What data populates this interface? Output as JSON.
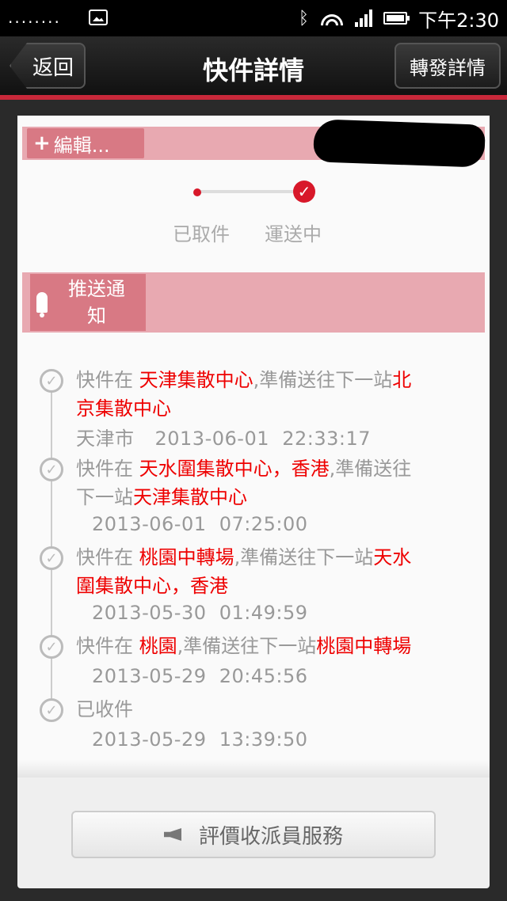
{
  "status_bar": {
    "left_text": "........",
    "time": "下午2:30"
  },
  "header": {
    "back_label": "返回",
    "title": "快件詳情",
    "forward_label": "轉發詳情"
  },
  "summary": {
    "edit_label": "編輯...",
    "steps": [
      "已取件",
      "運送中"
    ]
  },
  "notify": {
    "label_line1": "推送通",
    "label_line2": "知"
  },
  "timeline": [
    {
      "lines": [
        [
          {
            "t": "快件在 ",
            "red": false
          },
          {
            "t": "天津集散中心",
            "red": true
          },
          {
            "t": ",準備送往下一站",
            "red": false
          },
          {
            "t": "北",
            "red": true
          }
        ],
        [
          {
            "t": "京集散中心",
            "red": true
          }
        ]
      ],
      "location": "天津市",
      "time": "2013-06-01  22:33:17"
    },
    {
      "lines": [
        [
          {
            "t": "快件在 ",
            "red": false
          },
          {
            "t": "天水圍集散中心，香港",
            "red": true
          },
          {
            "t": ",準備送往",
            "red": false
          }
        ],
        [
          {
            "t": "下一站",
            "red": false
          },
          {
            "t": "天津集散中心",
            "red": true
          }
        ]
      ],
      "location": "",
      "time": "2013-06-01  07:25:00"
    },
    {
      "lines": [
        [
          {
            "t": "快件在 ",
            "red": false
          },
          {
            "t": "桃園中轉場",
            "red": true
          },
          {
            "t": ",準備送往下一站",
            "red": false
          },
          {
            "t": "天水",
            "red": true
          }
        ],
        [
          {
            "t": "圍集散中心，香港",
            "red": true
          }
        ]
      ],
      "location": "",
      "time": "2013-05-30  01:49:59"
    },
    {
      "lines": [
        [
          {
            "t": "快件在 ",
            "red": false
          },
          {
            "t": "桃園",
            "red": true
          },
          {
            "t": ",準備送往下一站",
            "red": false
          },
          {
            "t": "桃園中轉場",
            "red": true
          }
        ]
      ],
      "location": "",
      "time": "2013-05-29  20:45:56"
    },
    {
      "lines": [
        [
          {
            "t": "已收件",
            "red": false
          }
        ]
      ],
      "location": "",
      "time": "2013-05-29  13:39:50"
    }
  ],
  "rate_button_label": "評價收派員服務"
}
